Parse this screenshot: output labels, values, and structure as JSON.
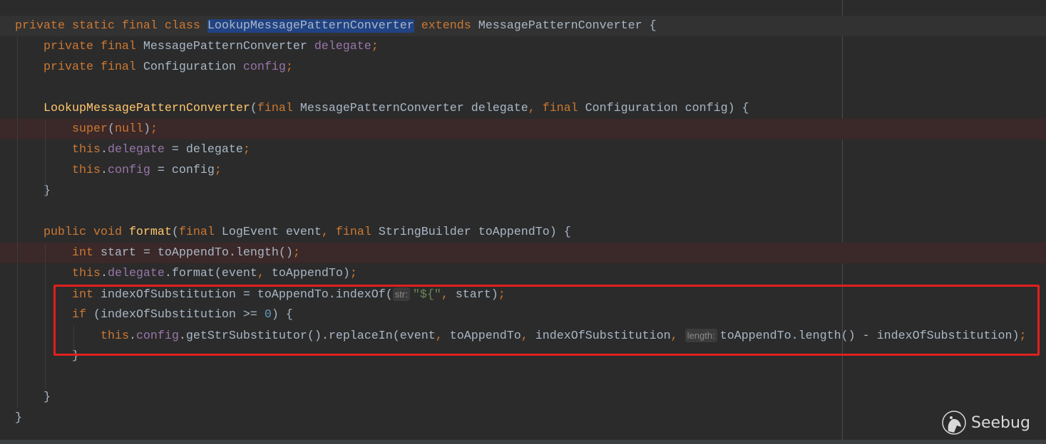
{
  "editor": {
    "lines": [
      {
        "state": "current",
        "tokens": [
          [
            "k",
            "private static final class "
          ],
          [
            "sel",
            "LookupMessagePatternConverter"
          ],
          [
            "k",
            " extends "
          ],
          [
            "t",
            "MessagePatternConverter {"
          ]
        ]
      },
      {
        "tokens": [
          [
            "t",
            "    "
          ],
          [
            "k",
            "private final "
          ],
          [
            "t",
            "MessagePatternConverter "
          ],
          [
            "f",
            "delegate"
          ],
          [
            "k",
            ";"
          ]
        ]
      },
      {
        "tokens": [
          [
            "t",
            "    "
          ],
          [
            "k",
            "private final "
          ],
          [
            "t",
            "Configuration "
          ],
          [
            "f",
            "config"
          ],
          [
            "k",
            ";"
          ]
        ]
      },
      {
        "tokens": []
      },
      {
        "tokens": [
          [
            "t",
            "    "
          ],
          [
            "m",
            "LookupMessagePatternConverter"
          ],
          [
            "t",
            "("
          ],
          [
            "k",
            "final "
          ],
          [
            "t",
            "MessagePatternConverter delegate"
          ],
          [
            "k",
            ", final "
          ],
          [
            "t",
            "Configuration config) {"
          ]
        ]
      },
      {
        "state": "error",
        "tokens": [
          [
            "t",
            "        "
          ],
          [
            "k",
            "super"
          ],
          [
            "t",
            "("
          ],
          [
            "k",
            "null"
          ],
          [
            "t",
            ")"
          ],
          [
            "k",
            ";"
          ]
        ]
      },
      {
        "tokens": [
          [
            "t",
            "        "
          ],
          [
            "k",
            "this"
          ],
          [
            "t",
            "."
          ],
          [
            "f",
            "delegate"
          ],
          [
            "t",
            " = delegate"
          ],
          [
            "k",
            ";"
          ]
        ]
      },
      {
        "tokens": [
          [
            "t",
            "        "
          ],
          [
            "k",
            "this"
          ],
          [
            "t",
            "."
          ],
          [
            "f",
            "config"
          ],
          [
            "t",
            " = config"
          ],
          [
            "k",
            ";"
          ]
        ]
      },
      {
        "tokens": [
          [
            "t",
            "    }"
          ]
        ]
      },
      {
        "tokens": []
      },
      {
        "tokens": [
          [
            "t",
            "    "
          ],
          [
            "k",
            "public void "
          ],
          [
            "m",
            "format"
          ],
          [
            "t",
            "("
          ],
          [
            "k",
            "final "
          ],
          [
            "t",
            "LogEvent event"
          ],
          [
            "k",
            ", final "
          ],
          [
            "t",
            "StringBuilder toAppendTo) {"
          ]
        ]
      },
      {
        "state": "error",
        "tokens": [
          [
            "t",
            "        "
          ],
          [
            "k",
            "int "
          ],
          [
            "t",
            "start = toAppendTo.length()"
          ],
          [
            "k",
            ";"
          ]
        ]
      },
      {
        "tokens": [
          [
            "t",
            "        "
          ],
          [
            "k",
            "this"
          ],
          [
            "t",
            "."
          ],
          [
            "f",
            "delegate"
          ],
          [
            "t",
            ".format(event"
          ],
          [
            "k",
            ", "
          ],
          [
            "t",
            "toAppendTo)"
          ],
          [
            "k",
            ";"
          ]
        ]
      },
      {
        "tokens": [
          [
            "t",
            "        "
          ],
          [
            "k",
            "int "
          ],
          [
            "t",
            "indexOfSubstitution = toAppendTo.indexOf("
          ],
          [
            "h",
            "str:"
          ],
          [
            "s",
            "\"${\""
          ],
          [
            "k",
            ", "
          ],
          [
            "t",
            "start)"
          ],
          [
            "k",
            ";"
          ]
        ]
      },
      {
        "tokens": [
          [
            "t",
            "        "
          ],
          [
            "k",
            "if "
          ],
          [
            "t",
            "(indexOfSubstitution >= "
          ],
          [
            "n",
            "0"
          ],
          [
            "t",
            ") {"
          ]
        ]
      },
      {
        "tokens": [
          [
            "t",
            "            "
          ],
          [
            "k",
            "this"
          ],
          [
            "t",
            "."
          ],
          [
            "f",
            "config"
          ],
          [
            "t",
            ".getStrSubstitutor().replaceIn(event"
          ],
          [
            "k",
            ", "
          ],
          [
            "t",
            "toAppendTo"
          ],
          [
            "k",
            ", "
          ],
          [
            "t",
            "indexOfSubstitution"
          ],
          [
            "k",
            ", "
          ],
          [
            "h",
            "length:"
          ],
          [
            "t",
            "toAppendTo.length() - indexOfSubstitution)"
          ],
          [
            "k",
            ";"
          ]
        ]
      },
      {
        "tokens": [
          [
            "t",
            "        }"
          ]
        ]
      },
      {
        "tokens": []
      },
      {
        "tokens": [
          [
            "t",
            "    }"
          ]
        ]
      },
      {
        "tokens": [
          [
            "t",
            "}"
          ]
        ]
      }
    ]
  },
  "watermark": {
    "text": "Seebug"
  },
  "colors": {
    "keyword": "#cc7832",
    "text": "#a9b7c6",
    "field": "#9876aa",
    "method": "#ffc66d",
    "string": "#6a8759",
    "number": "#6897bb",
    "annotation_box": "#e0201c"
  }
}
